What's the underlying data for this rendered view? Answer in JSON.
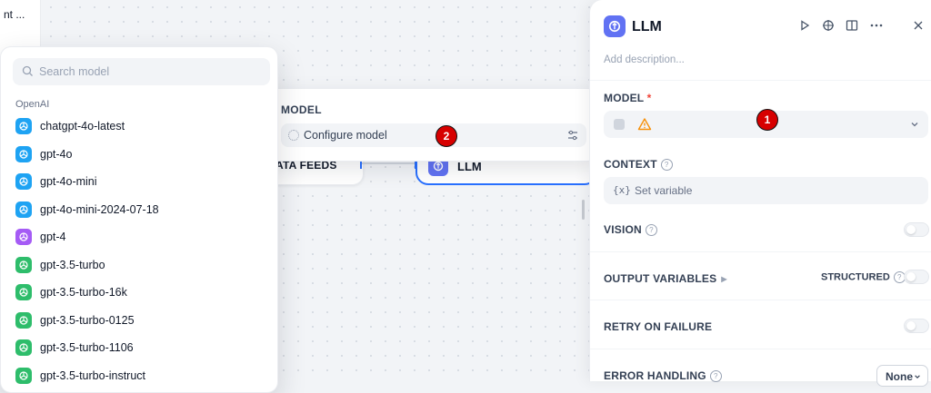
{
  "sidebar_snippet": "nt ...",
  "canvas": {
    "feeds_node_label": "ATA FEEDS",
    "llm_node_label": "LLM"
  },
  "model_popover": {
    "title": "MODEL",
    "configure_placeholder": "Configure model"
  },
  "model_list": {
    "search_placeholder": "Search model",
    "provider": "OpenAI",
    "items": [
      {
        "name": "chatgpt-4o-latest",
        "color": "#1ea3f3"
      },
      {
        "name": "gpt-4o",
        "color": "#1ea3f3"
      },
      {
        "name": "gpt-4o-mini",
        "color": "#1ea3f3"
      },
      {
        "name": "gpt-4o-mini-2024-07-18",
        "color": "#1ea3f3"
      },
      {
        "name": "gpt-4",
        "color": "#a55bf5"
      },
      {
        "name": "gpt-3.5-turbo",
        "color": "#2ebd6b"
      },
      {
        "name": "gpt-3.5-turbo-16k",
        "color": "#2ebd6b"
      },
      {
        "name": "gpt-3.5-turbo-0125",
        "color": "#2ebd6b"
      },
      {
        "name": "gpt-3.5-turbo-1106",
        "color": "#2ebd6b"
      },
      {
        "name": "gpt-3.5-turbo-instruct",
        "color": "#2ebd6b"
      }
    ]
  },
  "panel": {
    "title": "LLM",
    "description_placeholder": "Add description...",
    "model_label": "MODEL",
    "required_mark": "*",
    "context_label": "CONTEXT",
    "context_placeholder": "Set variable",
    "context_prefix": "{x}",
    "vision_label": "VISION",
    "output_variables_label": "OUTPUT VARIABLES",
    "structured_label": "STRUCTURED",
    "retry_label": "RETRY ON FAILURE",
    "error_handling_label": "ERROR HANDLING",
    "error_handling_value": "None"
  },
  "badges": {
    "one": "1",
    "two": "2"
  },
  "colors": {
    "accent": "#2970ff",
    "llm_icon": "#6172f3",
    "badge": "#d70000",
    "warning": "#f79009"
  }
}
